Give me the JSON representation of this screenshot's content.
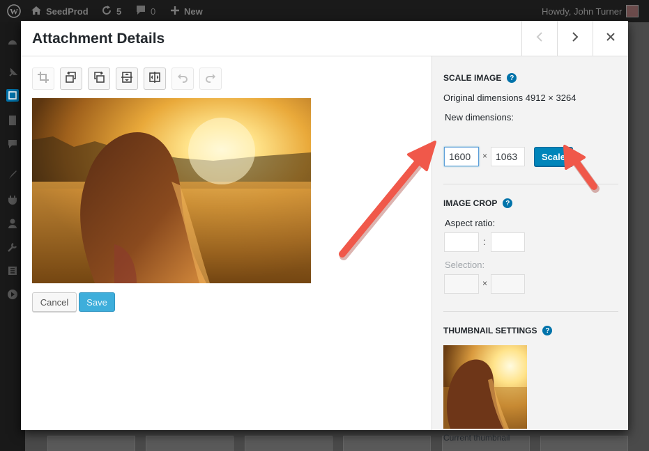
{
  "admin_bar": {
    "site_name": "SeedProd",
    "updates_count": "5",
    "comments_count": "0",
    "new_label": "New",
    "greeting": "Howdy, John Turner"
  },
  "modal": {
    "title": "Attachment Details"
  },
  "editor": {
    "cancel_label": "Cancel",
    "save_label": "Save"
  },
  "scale_image": {
    "heading": "Scale Image",
    "help": "?",
    "original_dimensions": "Original dimensions 4912 × 3264",
    "new_dimensions_label": "New dimensions:",
    "width_value": "1600",
    "height_value": "1063",
    "times": "×",
    "scale_label": "Scale"
  },
  "image_crop": {
    "heading": "Image Crop",
    "help": "?",
    "aspect_ratio_label": "Aspect ratio:",
    "colon": ":",
    "selection_label": "Selection:",
    "times": "×"
  },
  "thumbnail_settings": {
    "heading": "Thumbnail Settings",
    "help": "?",
    "caption": "Current thumbnail"
  },
  "colors": {
    "admin_bar": "#1a1a1a",
    "primary_button": "#0085ba",
    "help_icon": "#0073aa",
    "annotation_arrow": "#f0584a"
  }
}
